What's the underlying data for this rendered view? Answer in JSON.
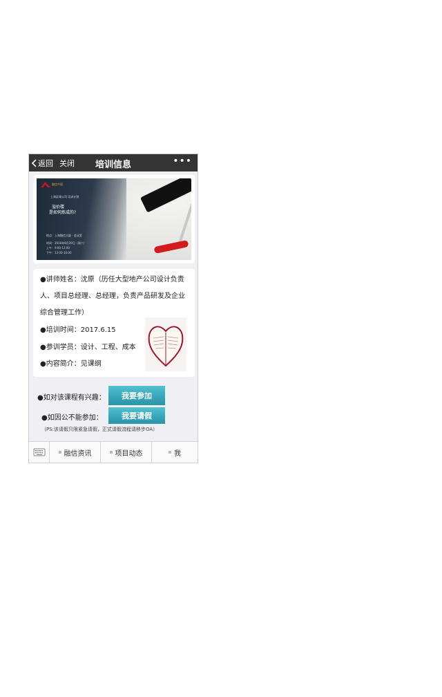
{
  "titlebar": {
    "back_label": "返回",
    "close_label": "关闭",
    "title": "培训信息",
    "more_label": "•••"
  },
  "banner": {
    "logo_text": "融信中国",
    "subtitle": "上海区域公司 培训计划",
    "headline_1": "溢价楼",
    "headline_2": "是如何炼成的?",
    "line_1": "地点：上海融信大厦 · 会议室",
    "line_2": "时间：2016年8月20日（周六）",
    "line_3": "上午：9:00-12:00",
    "line_4": "下午：13:00-16:00"
  },
  "info": {
    "lines": [
      "●讲师姓名：沈原（历任大型地产公司设计负责",
      "人、项目总经理、总经理，负责产品研发及企业",
      "综合管理工作）",
      "●培训时间：2017.6.15",
      "●参训学员：设计、工程、成本",
      "●内容简介：见课纲"
    ]
  },
  "actions": {
    "join_prompt": "●如对该课程有兴趣：",
    "join_button": "我要参加",
    "leave_prompt": "●如因公不能参加：",
    "leave_button": "我要请假",
    "ps_note": "（PS:该请假只限紧急请假，正式请假流程请移步OA）"
  },
  "tabbar": {
    "tabs": [
      "融信资讯",
      "项目动态",
      "我"
    ]
  },
  "colors": {
    "titlebar": "#343434",
    "button": "#3aa9bd",
    "accent_red": "#c8161d"
  }
}
